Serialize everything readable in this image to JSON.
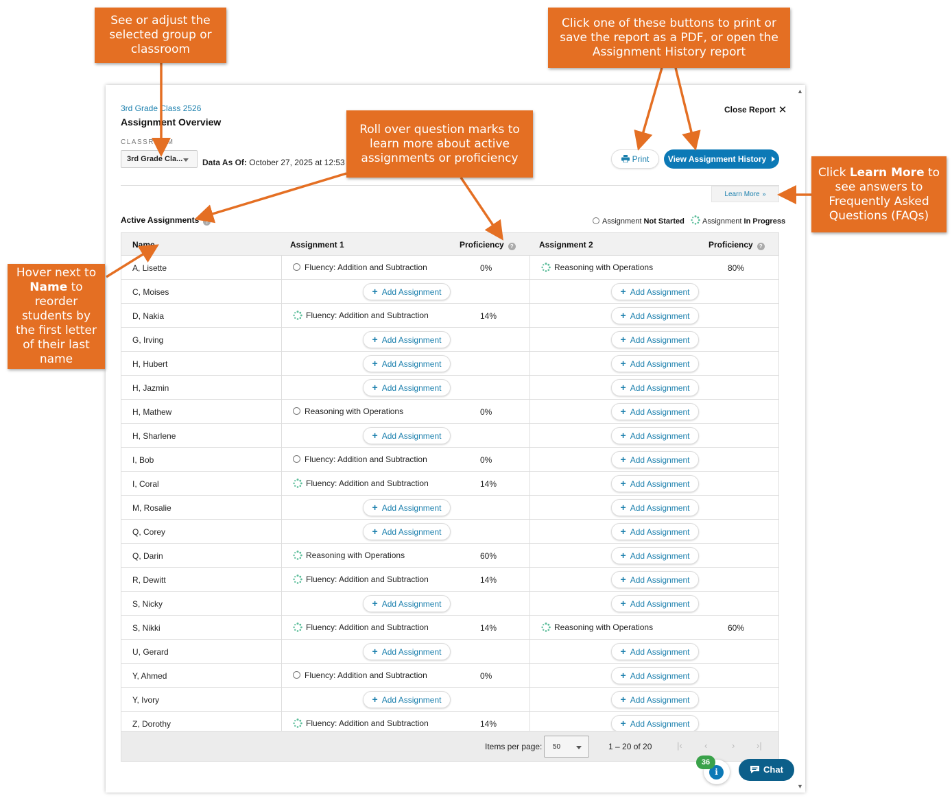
{
  "header": {
    "breadcrumb": "3rd Grade Class 2526",
    "title": "Assignment Overview",
    "close_label": "Close Report",
    "classroom_label": "CLASSROOM",
    "classroom_value": "3rd Grade Cla...",
    "data_as_of_label": "Data As Of:",
    "data_as_of_value": "October 27, 2025 at 12:53 PM",
    "print_label": "Print",
    "history_label": "View Assignment History",
    "learn_more_label": "Learn More"
  },
  "active_assignments_label": "Active Assignments",
  "legend": {
    "not_started_prefix": "Assignment",
    "not_started_label": "Not Started",
    "in_progress_prefix": "Assignment",
    "in_progress_label": "In Progress"
  },
  "columns": {
    "name": "Name",
    "assignment1": "Assignment 1",
    "proficiency1": "Proficiency",
    "assignment2": "Assignment 2",
    "proficiency2": "Proficiency"
  },
  "add_label": "Add Assignment",
  "rows": [
    {
      "name": "A, Lisette",
      "a1": {
        "status": "not-started",
        "title": "Fluency: Addition and Subtraction",
        "prof": "0%"
      },
      "a2": {
        "status": "in-progress",
        "title": "Reasoning with Operations",
        "prof": "80%"
      }
    },
    {
      "name": "C, Moises",
      "a1": null,
      "a2": null
    },
    {
      "name": "D, Nakia",
      "a1": {
        "status": "in-progress",
        "title": "Fluency: Addition and Subtraction",
        "prof": "14%"
      },
      "a2": null
    },
    {
      "name": "G, Irving",
      "a1": null,
      "a2": null
    },
    {
      "name": "H, Hubert",
      "a1": null,
      "a2": null
    },
    {
      "name": "H, Jazmin",
      "a1": null,
      "a2": null
    },
    {
      "name": "H, Mathew",
      "a1": {
        "status": "not-started",
        "title": "Reasoning with Operations",
        "prof": "0%"
      },
      "a2": null
    },
    {
      "name": "H, Sharlene",
      "a1": null,
      "a2": null
    },
    {
      "name": "I, Bob",
      "a1": {
        "status": "not-started",
        "title": "Fluency: Addition and Subtraction",
        "prof": "0%"
      },
      "a2": null
    },
    {
      "name": "I, Coral",
      "a1": {
        "status": "in-progress",
        "title": "Fluency: Addition and Subtraction",
        "prof": "14%"
      },
      "a2": null
    },
    {
      "name": "M, Rosalie",
      "a1": null,
      "a2": null
    },
    {
      "name": "Q, Corey",
      "a1": null,
      "a2": null
    },
    {
      "name": "Q, Darin",
      "a1": {
        "status": "in-progress",
        "title": "Reasoning with Operations",
        "prof": "60%"
      },
      "a2": null
    },
    {
      "name": "R, Dewitt",
      "a1": {
        "status": "in-progress",
        "title": "Fluency: Addition and Subtraction",
        "prof": "14%"
      },
      "a2": null
    },
    {
      "name": "S, Nicky",
      "a1": null,
      "a2": null
    },
    {
      "name": "S, Nikki",
      "a1": {
        "status": "in-progress",
        "title": "Fluency: Addition and Subtraction",
        "prof": "14%"
      },
      "a2": {
        "status": "in-progress",
        "title": "Reasoning with Operations",
        "prof": "60%"
      }
    },
    {
      "name": "U, Gerard",
      "a1": null,
      "a2": null
    },
    {
      "name": "Y, Ahmed",
      "a1": {
        "status": "not-started",
        "title": "Fluency: Addition and Subtraction",
        "prof": "0%"
      },
      "a2": null
    },
    {
      "name": "Y, Ivory",
      "a1": null,
      "a2": null
    },
    {
      "name": "Z, Dorothy",
      "a1": {
        "status": "in-progress",
        "title": "Fluency: Addition and Subtraction",
        "prof": "14%"
      },
      "a2": null
    }
  ],
  "pagination": {
    "items_per_page_label": "Items per page:",
    "items_per_page_value": "50",
    "range": "1 – 20 of 20"
  },
  "chat_label": "Chat",
  "info_badge_count": "36",
  "callouts": {
    "classroom": "See or adjust the selected group or classroom",
    "buttons": "Click one of these buttons to print or save the report as a PDF, or open the Assignment History report",
    "question_marks": "Roll over question marks to learn more about active assignments or proficiency",
    "learn_more_pre": "Click",
    "learn_more_bold": "Learn More",
    "learn_more_post": "to see answers to Frequently Asked Questions (FAQs)",
    "name_pre": "Hover next to",
    "name_bold": "Name",
    "name_post": "to reorder students by the first letter of their last name"
  },
  "colors": {
    "accent": "#0c79b6",
    "callout": "#e46f23",
    "badge": "#3aa24a",
    "chat": "#0c5f8a"
  }
}
